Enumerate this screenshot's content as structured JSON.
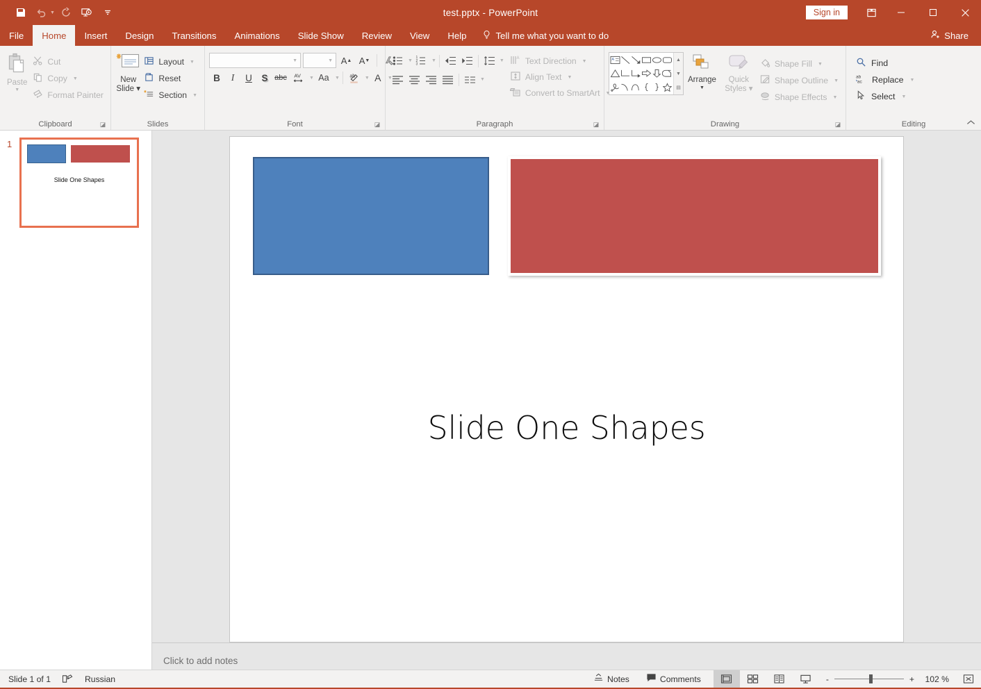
{
  "titlebar": {
    "document_title": "test.pptx  -  PowerPoint",
    "signin_label": "Sign in",
    "qat": [
      {
        "name": "save-icon",
        "label": "Save",
        "enabled": true
      },
      {
        "name": "undo-icon",
        "label": "Undo",
        "enabled": false
      },
      {
        "name": "redo-icon",
        "label": "Redo",
        "enabled": false
      },
      {
        "name": "start-from-beginning-icon",
        "label": "Start From Beginning",
        "enabled": true
      },
      {
        "name": "customize-quick-access-toolbar-icon",
        "label": "Customize Quick Access Toolbar",
        "enabled": true
      }
    ],
    "window_controls": [
      "minimize",
      "maximize",
      "close"
    ],
    "ribbon_display_options": "Ribbon Display Options"
  },
  "tabs": [
    {
      "label": "File",
      "active": false
    },
    {
      "label": "Home",
      "active": true
    },
    {
      "label": "Insert",
      "active": false
    },
    {
      "label": "Design",
      "active": false
    },
    {
      "label": "Transitions",
      "active": false
    },
    {
      "label": "Animations",
      "active": false
    },
    {
      "label": "Slide Show",
      "active": false
    },
    {
      "label": "Review",
      "active": false
    },
    {
      "label": "View",
      "active": false
    },
    {
      "label": "Help",
      "active": false
    }
  ],
  "tellme": {
    "label": "Tell me what you want to do",
    "icon": "lightbulb-icon"
  },
  "share": {
    "label": "Share",
    "icon": "share-person-icon"
  },
  "ribbon": {
    "clipboard": {
      "group_label": "Clipboard",
      "paste_label": "Paste",
      "commands": [
        {
          "label": "Cut",
          "icon": "scissors-icon"
        },
        {
          "label": "Copy",
          "icon": "copy-icon"
        },
        {
          "label": "Format Painter",
          "icon": "format-painter-icon"
        }
      ]
    },
    "slides": {
      "group_label": "Slides",
      "new_slide_line1": "New",
      "new_slide_line2": "Slide",
      "commands": [
        {
          "label": "Layout",
          "icon": "layout-icon"
        },
        {
          "label": "Reset",
          "icon": "reset-icon"
        },
        {
          "label": "Section",
          "icon": "section-icon"
        }
      ]
    },
    "font": {
      "group_label": "Font",
      "font_name_value": "",
      "font_name_placeholder": "",
      "font_size_value": "",
      "font_size_placeholder": "",
      "buttons": [
        {
          "name": "increase-font-size-button",
          "glyph": "A"
        },
        {
          "name": "decrease-font-size-button",
          "glyph": "A"
        },
        {
          "name": "clear-formatting-button",
          "glyph": "A"
        },
        {
          "name": "bold-button",
          "glyph": "B"
        },
        {
          "name": "italic-button",
          "glyph": "I"
        },
        {
          "name": "underline-button",
          "glyph": "U"
        },
        {
          "name": "text-shadow-button",
          "glyph": "S"
        },
        {
          "name": "strikethrough-button",
          "glyph": "abc"
        },
        {
          "name": "character-spacing-button",
          "glyph": "AV"
        },
        {
          "name": "change-case-button",
          "glyph": "Aa"
        },
        {
          "name": "text-highlight-color-button",
          "glyph": "ab"
        },
        {
          "name": "font-color-button",
          "glyph": "A"
        }
      ]
    },
    "paragraph": {
      "group_label": "Paragraph",
      "commands": [
        {
          "label": "Text Direction",
          "icon": "text-direction-icon"
        },
        {
          "label": "Align Text",
          "icon": "align-text-icon"
        },
        {
          "label": "Convert to SmartArt",
          "icon": "smartart-icon"
        }
      ]
    },
    "drawing": {
      "group_label": "Drawing",
      "arrange_label": "Arrange",
      "quick_styles_line1": "Quick",
      "quick_styles_line2": "Styles",
      "shapes": [
        "text-box-shape",
        "line-shape",
        "arrow-shape",
        "rectangle-shape",
        "oval-shape",
        "rounded-rectangle-shape",
        "triangle-shape",
        "elbow-connector-shape",
        "elbow-arrow-connector-shape",
        "right-arrow-shape",
        "down-arrow-shape",
        "flowchart-shape",
        "scribble-shape",
        "curve-shape",
        "arc-shape",
        "left-brace-shape",
        "right-brace-shape",
        "star-shape"
      ],
      "commands": [
        {
          "label": "Shape Fill",
          "icon": "shape-fill-icon"
        },
        {
          "label": "Shape Outline",
          "icon": "shape-outline-icon"
        },
        {
          "label": "Shape Effects",
          "icon": "shape-effects-icon"
        }
      ]
    },
    "editing": {
      "group_label": "Editing",
      "commands": [
        {
          "label": "Find",
          "icon": "search-icon"
        },
        {
          "label": "Replace",
          "icon": "replace-icon"
        },
        {
          "label": "Select",
          "icon": "select-cursor-icon"
        }
      ]
    }
  },
  "thumbnails": [
    {
      "number": "1",
      "title": "Slide One Shapes",
      "selected": true
    }
  ],
  "slide": {
    "title": "Slide One Shapes",
    "shapes": [
      {
        "name": "blue-rectangle",
        "fill": "#4E81BC",
        "outline": "#385D8A"
      },
      {
        "name": "red-rectangle",
        "fill": "#BF504D",
        "outline": "#FFFFFF"
      }
    ]
  },
  "notes": {
    "placeholder": "Click to add notes"
  },
  "statusbar": {
    "slide_count": "Slide 1 of 1",
    "proofing_icon": "proofing-icon",
    "language": "Russian",
    "notes_label": "Notes",
    "comments_label": "Comments",
    "views": [
      {
        "name": "normal-view-button",
        "active": true
      },
      {
        "name": "slide-sorter-view-button",
        "active": false
      },
      {
        "name": "reading-view-button",
        "active": false
      },
      {
        "name": "slide-show-view-button",
        "active": false
      }
    ],
    "zoom_out": "-",
    "zoom_in": "+",
    "zoom_level": "102 %",
    "fit_to_window": "fit-slide-to-window-icon"
  },
  "colors": {
    "brand": "#B7472A",
    "ribbon_bg": "#F3F2F1",
    "canvas_bg": "#E6E6E6",
    "thumb_select": "#E8714F"
  }
}
